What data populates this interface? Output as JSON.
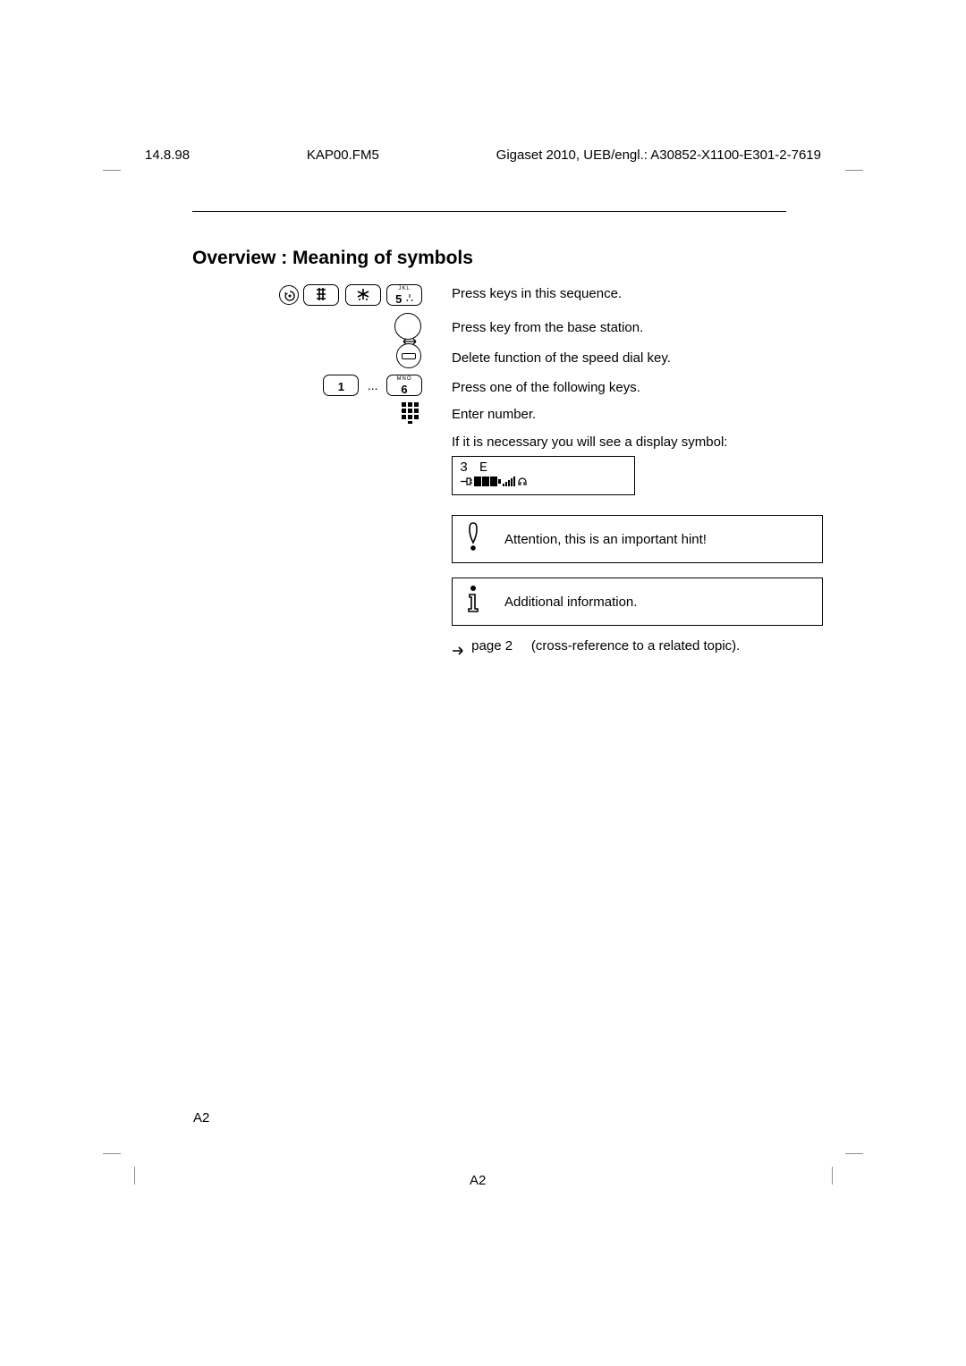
{
  "header": {
    "left": "14.8.98",
    "middle": "KAP00.FM5",
    "right": "Gigaset 2010, UEB/engl.: A30852-X1100-E301-2-7619"
  },
  "heading": "Overview : Meaning of symbols",
  "rows": {
    "r1": {
      "text": "Press keys in this sequence.",
      "k3": "5",
      "k3sub": "JKL"
    },
    "r2": {
      "text": "Press key from the base station."
    },
    "r3": {
      "text": "Delete function of the speed dial key."
    },
    "r4": {
      "text": "Press one of the following keys.",
      "k1": "1",
      "k2": "6",
      "k2sub": "MNO",
      "sep": "..."
    },
    "r5": {
      "text": "Enter number."
    },
    "r6": {
      "text": "If it is necessary you will see a display symbol:"
    },
    "r7": {
      "display_l1": "3  E"
    },
    "r8": {
      "text": "Attention, this is an important hint!"
    },
    "r9": {
      "text": "Additional information."
    },
    "r10": {
      "text": "(cross-reference to a related topic).",
      "pref": "page 2"
    }
  },
  "footer": {
    "a2": "A2"
  }
}
